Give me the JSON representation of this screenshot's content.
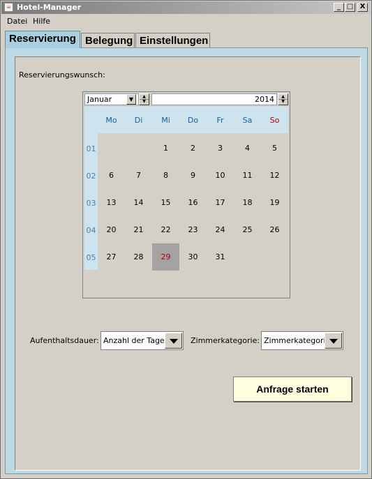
{
  "window": {
    "title": "Hotel-Manager",
    "controls": {
      "minimize": "_",
      "maximize": "□",
      "close": "X"
    }
  },
  "menu": {
    "items": [
      "Datei",
      "Hilfe"
    ]
  },
  "tabs": [
    "Reservierung",
    "Belegung",
    "Einstellungen"
  ],
  "active_tab": "Reservierung",
  "reservation": {
    "label": "Reservierungswunsch:",
    "calendar": {
      "month": "Januar",
      "year": "2014",
      "weekday_headers": [
        "Mo",
        "Di",
        "Mi",
        "Do",
        "Fr",
        "Sa",
        "So"
      ],
      "week_numbers": [
        "01",
        "02",
        "03",
        "04",
        "05"
      ],
      "weeks": [
        [
          "",
          "",
          "1",
          "2",
          "3",
          "4",
          "5"
        ],
        [
          "6",
          "7",
          "8",
          "9",
          "10",
          "11",
          "12"
        ],
        [
          "13",
          "14",
          "15",
          "16",
          "17",
          "18",
          "19"
        ],
        [
          "20",
          "21",
          "22",
          "23",
          "24",
          "25",
          "26"
        ],
        [
          "27",
          "28",
          "29",
          "30",
          "31",
          "",
          ""
        ]
      ],
      "selected_day": "29"
    },
    "stay_label": "Aufenthaltsdauer:",
    "stay_value": "Anzahl der Tage",
    "room_label": "Zimmerkategorie:",
    "room_value": "Zimmerkategorie",
    "submit_label": "Anfrage starten"
  },
  "colors": {
    "tab_active": "#a9cfe0",
    "selected_day_bg": "#a3a3a3",
    "weekday_header": "#1a5fa0",
    "sunday": "#b00000",
    "button_bg": "#ffffe0"
  }
}
